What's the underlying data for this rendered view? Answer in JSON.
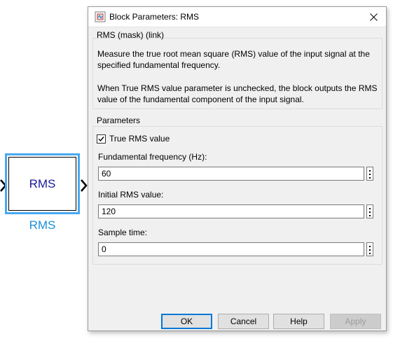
{
  "canvas": {
    "block": {
      "text": "RMS",
      "name": "RMS"
    }
  },
  "dialog": {
    "title": "Block Parameters: RMS",
    "mask": {
      "label": "RMS (mask) (link)",
      "description_1": "Measure the true root mean square (RMS) value of the input signal at the specified fundamental frequency.",
      "description_2": "When True RMS value parameter is unchecked, the block outputs the RMS value of the fundamental component of the input signal."
    },
    "parameters": {
      "label": "Parameters",
      "true_rms": {
        "label": "True RMS value",
        "checked": true
      },
      "fundamental_frequency": {
        "label": "Fundamental frequency (Hz):",
        "value": "60"
      },
      "initial_rms": {
        "label": "Initial RMS value:",
        "value": "120"
      },
      "sample_time": {
        "label": "Sample time:",
        "value": "0"
      }
    },
    "buttons": {
      "ok": "OK",
      "cancel": "Cancel",
      "help": "Help",
      "apply": "Apply"
    }
  }
}
